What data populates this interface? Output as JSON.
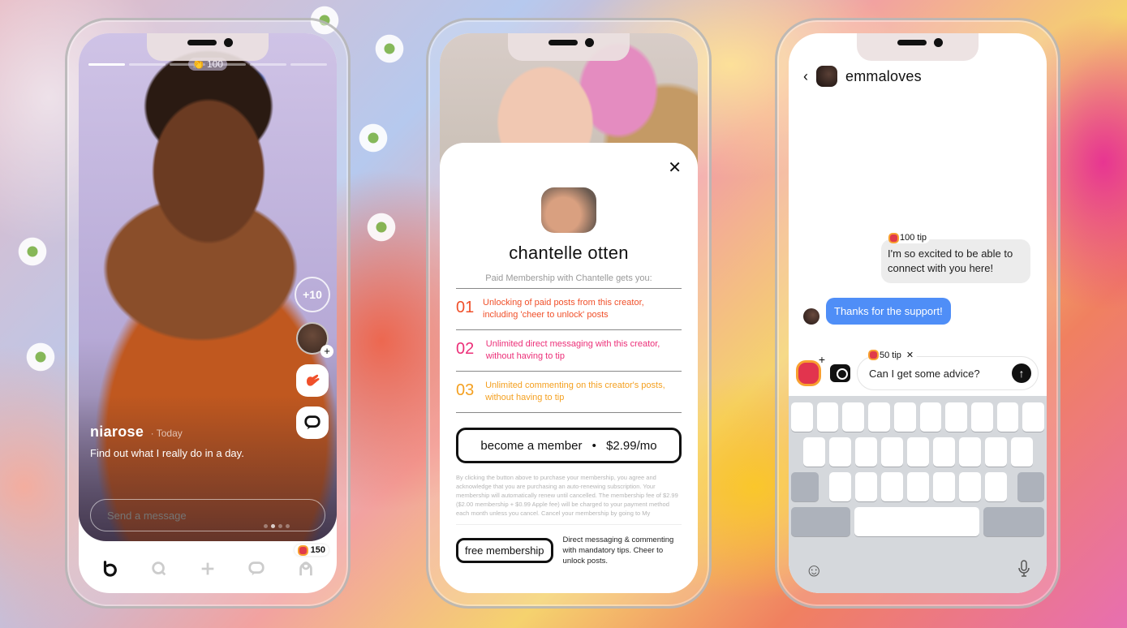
{
  "phones": {
    "feed": {
      "cheer_count": "100",
      "progress_segments_total": 6,
      "progress_segments_done": 1,
      "plus_cheer": "+10",
      "creator_name": "niarose",
      "post_time": "Today",
      "caption": "Find out what I really do in a day.",
      "message_placeholder": "Send a message",
      "coin_balance": "150",
      "page_dots_total": 4,
      "page_dot_active": 2,
      "nav": [
        {
          "icon": "home-icon",
          "active": true
        },
        {
          "icon": "search-icon",
          "active": false
        },
        {
          "icon": "plus-icon",
          "active": false
        },
        {
          "icon": "messages-icon",
          "active": false
        },
        {
          "icon": "profile-icon",
          "active": false
        }
      ]
    },
    "membership": {
      "creator_name": "chantelle otten",
      "subtitle": "Paid Membership with Chantelle gets you:",
      "benefits": [
        {
          "num": "01",
          "text": "Unlocking of paid posts from this creator, including 'cheer to unlock' posts",
          "color": "#f0502a"
        },
        {
          "num": "02",
          "text": "Unlimited direct messaging with this creator, without having to tip",
          "color": "#ec2f78"
        },
        {
          "num": "03",
          "text": "Unlimited commenting on this creator's posts, without having to tip",
          "color": "#f4a020"
        }
      ],
      "become_label": "become a member",
      "price": "$2.99/mo",
      "separator": "•",
      "legal": "By clicking the button above to purchase your membership, you agree and acknowledge that you are purchasing an auto-renewing subscription. Your membership will automatically renew until cancelled. The membership fee of $2.99 ($2.00 membership + $0.99 Apple fee) will be charged to your payment method each month unless you cancel. Cancel your membership by going to My",
      "free_label": "free membership",
      "free_desc": "Direct messaging & commenting with mandatory tips. Cheer to unlock posts."
    },
    "chat": {
      "username": "emmaloves",
      "incoming_tip": "100 tip",
      "incoming_text": "I'm so excited to be able to connect with you here!",
      "outgoing_text": "Thanks for the support!",
      "draft_tip": "50 tip",
      "draft_text": "Can I get some advice?",
      "keyboard_rows": [
        10,
        9,
        7
      ]
    }
  },
  "colors": {
    "accent_blue": "#4f8ef7",
    "coin_red": "#e03a4a",
    "coin_orange": "#f8a030"
  }
}
